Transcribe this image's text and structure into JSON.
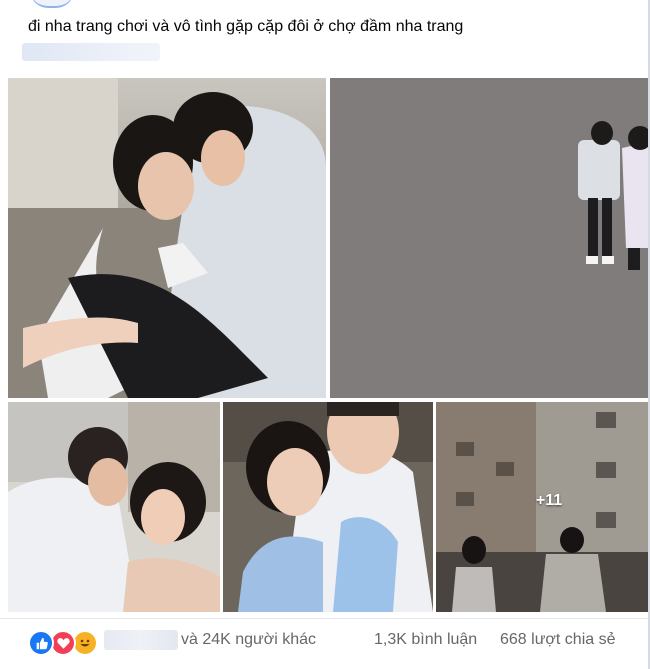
{
  "post": {
    "caption": "đi nha trang chơi và vô tình gặp cặp đôi ở  chợ đầm nha trang",
    "photos": [
      {
        "id": "photo-1",
        "subject": "couple-sitting-rooftop"
      },
      {
        "id": "photo-2",
        "subject": "couple-standing-on-pavement"
      },
      {
        "id": "photo-3",
        "subject": "couple-close-embrace"
      },
      {
        "id": "photo-4",
        "subject": "couple-selfie-smiling"
      },
      {
        "id": "photo-5",
        "subject": "couple-back-view-buildings"
      }
    ],
    "more_photos_label": "+11"
  },
  "footer": {
    "reactions": [
      "like-icon",
      "love-icon",
      "haha-icon"
    ],
    "others_text": "và 24K người khác",
    "comments_text": "1,3K bình luận",
    "shares_text": "668 lượt chia sẻ"
  },
  "colors": {
    "like": "#1877f2",
    "love": "#f33e58",
    "haha": "#f7b125",
    "muted_text": "#65676b"
  }
}
